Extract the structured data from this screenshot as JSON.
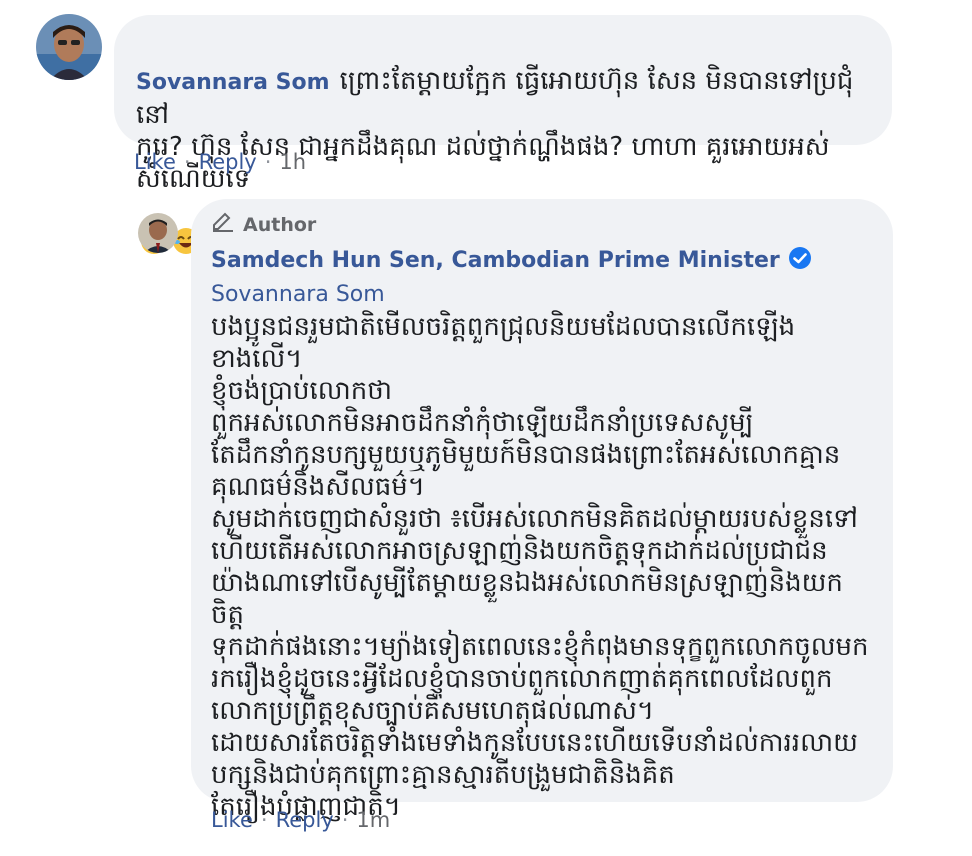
{
  "comment": {
    "author": "Sovannara Som",
    "text": "ព្រោះតែម្តាយក្អែក ធ្វើអោយហ៊ុន សែន មិនបានទៅប្រជុំនៅ\nកូរេ? ហ៊ុន សែន ជាអ្នកដឹងគុណ ដល់ថ្នាក់ណ្ហឹងផង? ហាហា គួរអោយអស់\nសំណើយទេ",
    "emojis": [
      "laughing-face-icon",
      "laughing-face-icon"
    ],
    "actions": {
      "like": "Like",
      "reply": "Reply",
      "time": "1h"
    }
  },
  "reply": {
    "badge": "Author",
    "author": "Samdech Hun Sen, Cambodian Prime Minister",
    "mention": "Sovannara Som",
    "lines": [
      "បងប្អូនជនរួមជាតិមើលចរិត្តពួកជ្រុលនិយមដែលបានលើកឡើង",
      "ខាងលើ។",
      "ខ្ញុំចង់ប្រាប់លោកថា",
      "ពួកអស់លោកមិនអាចដឹកនាំកុំថាឡើយដឹកនាំប្រទេសសូម្បី",
      "តែដឹកនាំកូនបក្សមួយឬភូមិមួយក៍មិនបានផងព្រោះតែអស់លោកគ្មាន",
      "គុណធម៌និងសីលធម៌។",
      "សូមដាក់ចេញជាសំនួរថា ៖បើអស់លោកមិនគិតដល់ម្តាយរបស់ខ្លួនទៅ",
      "ហើយតើអស់លោកអាចស្រឡាញ់និងយកចិត្តទុកដាក់ដល់ប្រជាជន",
      "យ៉ាងណាទៅបើសូម្បីតែម្តាយខ្លួនឯងអស់លោកមិនស្រឡាញ់និងយកចិត្ត",
      "ទុកដាក់ផងនោះ។ម្យ៉ាងទៀតពេលនេះខ្ញុំកំពុងមានទុក្ខពួកលោកចូលមក",
      "រករឿងខ្ញុំដូចនេះអ្វីដែលខ្ញុំបានចាប់ពួកលោកញាត់គុកពេលដែលពួក",
      "លោកប្រព្រឹត្តខុសច្បាប់គឺសមហេតុផល់ណាស់។",
      "ដោយសារតែចរិត្តទាំងមេទាំងកូនបែបនេះហើយទើបនាំដល់ការរលាយ",
      "បក្សនិងជាប់គុកព្រោះគ្មានស្មារតីបង្រួមជាតិនិងគិត",
      "តែរឿងបំផ្លាញជាតិ។"
    ],
    "actions": {
      "like": "Like",
      "reply": "Reply",
      "time": "1m"
    }
  },
  "colors": {
    "bubble": "#f0f2f5",
    "name": "#385898",
    "meta": "#65676b",
    "verified": "#1877f2"
  }
}
